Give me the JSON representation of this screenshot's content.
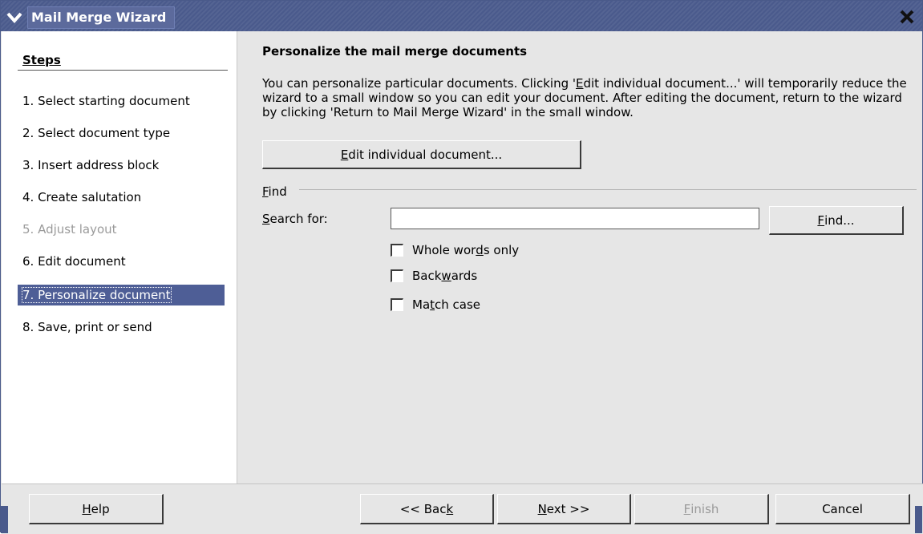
{
  "window": {
    "title": "Mail Merge Wizard",
    "title_color": "#4a5a8c"
  },
  "steps": {
    "heading": "Steps",
    "items": [
      {
        "label": "1. Select starting document",
        "state": "normal"
      },
      {
        "label": "2. Select document type",
        "state": "normal"
      },
      {
        "label": "3. Insert address block",
        "state": "normal"
      },
      {
        "label": "4. Create salutation",
        "state": "normal"
      },
      {
        "label": "5. Adjust layout",
        "state": "disabled"
      },
      {
        "label": "6. Edit document",
        "state": "normal"
      },
      {
        "label": "7. Personalize document",
        "state": "active"
      },
      {
        "label": "8. Save, print or send",
        "state": "normal"
      }
    ],
    "active_color": "#4e5e96"
  },
  "main": {
    "title": "Personalize the mail merge documents",
    "description_pre": "You can personalize particular documents. Clicking '",
    "description_hotkey": "E",
    "description_post": "dit individual document...' will temporarily reduce the wizard to a small window so you can edit your document. After editing the document, return to the wizard by clicking 'Return to Mail Merge Wizard' in the small window.",
    "edit_button": {
      "hotkey": "E",
      "rest": "dit individual document..."
    },
    "find_section": {
      "hotkey": "F",
      "rest": "ind"
    },
    "search_label": {
      "hotkey": "S",
      "rest": "earch for:"
    },
    "search_value": "",
    "find_button": {
      "hotkey": "F",
      "rest": "ind..."
    },
    "options": [
      {
        "pre": "Whole wor",
        "hotkey": "d",
        "post": "s only",
        "checked": false
      },
      {
        "pre": "Back",
        "hotkey": "w",
        "post": "ards",
        "checked": false
      },
      {
        "pre": "Ma",
        "hotkey": "t",
        "post": "ch case",
        "checked": false
      }
    ]
  },
  "footer": {
    "help": {
      "hotkey": "H",
      "rest": "elp"
    },
    "back": {
      "pre": "<< Bac",
      "hotkey": "k"
    },
    "next": {
      "hotkey": "N",
      "rest": "ext >>"
    },
    "finish": {
      "hotkey": "F",
      "rest": "inish",
      "disabled": true
    },
    "cancel": "Cancel"
  }
}
